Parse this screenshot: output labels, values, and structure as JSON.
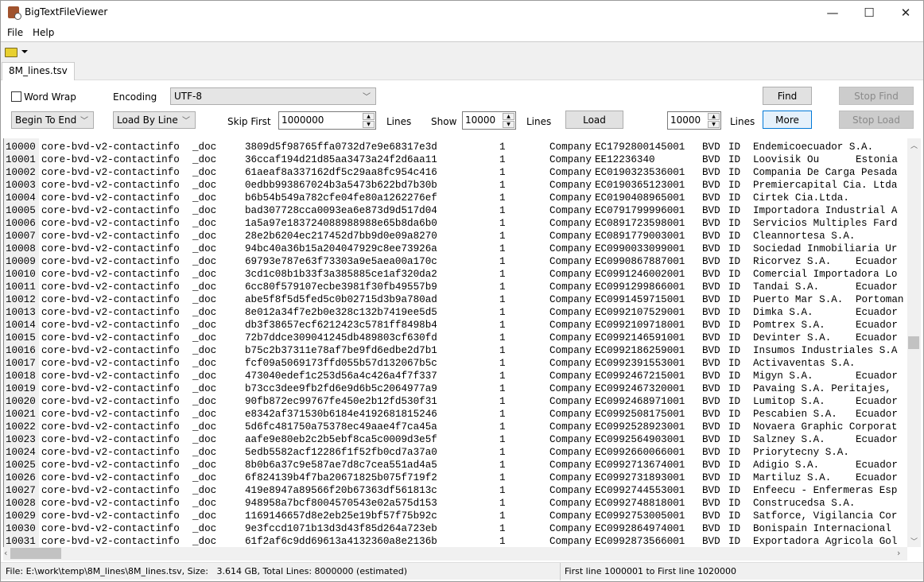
{
  "window": {
    "title": "BigTextFileViewer",
    "minimize": "—",
    "maximize": "☐",
    "close": "✕"
  },
  "menu": [
    "File",
    "Help"
  ],
  "toolbar": {
    "open_icon": "folder-open-icon",
    "dropdown_icon": "caret-down-icon"
  },
  "tab": {
    "label": "8M_lines.tsv"
  },
  "controls": {
    "word_wrap_label": "Word Wrap",
    "word_wrap_checked": false,
    "encoding_label": "Encoding",
    "encoding_value": "UTF-8",
    "direction_value": "Begin To End",
    "load_mode_value": "Load By Line",
    "skip_first_label": "Skip First",
    "skip_first_value": "1000000",
    "lines_label": "Lines",
    "show_label": "Show",
    "show_value": "10000",
    "load_label": "Load",
    "more_count_value": "10000",
    "more_label": "More",
    "find_label": "Find",
    "stop_find_label": "Stop Find",
    "stop_load_label": "Stop Load"
  },
  "rows": [
    [
      "10000",
      "core-bvd-v2-contactinfo",
      "_doc",
      "3809d5f98765ffa0732d7e9e68317e3d",
      "1",
      "Company",
      "EC1792800145001",
      "BVD",
      "ID",
      "Endemicoecuador S.A.",
      ""
    ],
    [
      "10001",
      "core-bvd-v2-contactinfo",
      "_doc",
      "36ccaf194d21d85aa3473a24f2d6aa11",
      "1",
      "Company",
      "EE12236340",
      "BVD",
      "ID",
      "Loovisik Ou",
      "Estonia"
    ],
    [
      "10002",
      "core-bvd-v2-contactinfo",
      "_doc",
      "61aeaf8a337162df5c29aa8fc954c416",
      "1",
      "Company",
      "EC0190323536001",
      "BVD",
      "ID",
      "Compania De Carga Pesada",
      ""
    ],
    [
      "10003",
      "core-bvd-v2-contactinfo",
      "_doc",
      "0edbb993867024b3a5473b622bd7b30b",
      "1",
      "Company",
      "EC0190365123001",
      "BVD",
      "ID",
      "Premiercapital Cia. Ltda",
      ""
    ],
    [
      "10004",
      "core-bvd-v2-contactinfo",
      "_doc",
      "b6b54b549a782cfe04fe80a1262276ef",
      "1",
      "Company",
      "EC0190408965001",
      "BVD",
      "ID",
      "Cirtek Cia.Ltda.",
      ""
    ],
    [
      "10005",
      "core-bvd-v2-contactinfo",
      "_doc",
      "bad307728cca0093ea6e873d9d517d04",
      "1",
      "Company",
      "EC0791799996001",
      "BVD",
      "ID",
      "Importadora Industrial A",
      ""
    ],
    [
      "10006",
      "core-bvd-v2-contactinfo",
      "_doc",
      "1a5a97e183724088988988e65b8da6b0",
      "1",
      "Company",
      "EC0891723598001",
      "BVD",
      "ID",
      "Servicios Multiples Fard",
      ""
    ],
    [
      "10007",
      "core-bvd-v2-contactinfo",
      "_doc",
      "28e2b6204ec217452d7bb9d0e09a8270",
      "1",
      "Company",
      "EC0891779003001",
      "BVD",
      "ID",
      "Cleannortesa S.A.",
      ""
    ],
    [
      "10008",
      "core-bvd-v2-contactinfo",
      "_doc",
      "94bc40a36b15a204047929c8ee73926a",
      "1",
      "Company",
      "EC0990033099001",
      "BVD",
      "ID",
      "Sociedad Inmobiliaria Ur",
      ""
    ],
    [
      "10009",
      "core-bvd-v2-contactinfo",
      "_doc",
      "69793e787e63f73303a9e5aea00a170c",
      "1",
      "Company",
      "EC0990867887001",
      "BVD",
      "ID",
      "Ricorvez S.A.",
      "Ecuador"
    ],
    [
      "10010",
      "core-bvd-v2-contactinfo",
      "_doc",
      "3cd1c08b1b33f3a385885ce1af320da2",
      "1",
      "Company",
      "EC0991246002001",
      "BVD",
      "ID",
      "Comercial Importadora Lo",
      ""
    ],
    [
      "10011",
      "core-bvd-v2-contactinfo",
      "_doc",
      "6cc80f579107ecbe3981f30fb49557b9",
      "1",
      "Company",
      "EC0991299866001",
      "BVD",
      "ID",
      "Tandai S.A.",
      "Ecuador"
    ],
    [
      "10012",
      "core-bvd-v2-contactinfo",
      "_doc",
      "abe5f8f5d5fed5c0b02715d3b9a780ad",
      "1",
      "Company",
      "EC0991459715001",
      "BVD",
      "ID",
      "Puerto Mar S.A.",
      "Portoman"
    ],
    [
      "10013",
      "core-bvd-v2-contactinfo",
      "_doc",
      "8e012a34f7e2b0e328c132b7419ee5d5",
      "1",
      "Company",
      "EC0992107529001",
      "BVD",
      "ID",
      "Dimka S.A.",
      "Ecuador"
    ],
    [
      "10014",
      "core-bvd-v2-contactinfo",
      "_doc",
      "db3f38657ecf6212423c5781ff8498b4",
      "1",
      "Company",
      "EC0992109718001",
      "BVD",
      "ID",
      "Pomtrex S.A.",
      "Ecuador"
    ],
    [
      "10015",
      "core-bvd-v2-contactinfo",
      "_doc",
      "72b7ddce309041245db489803cf630fd",
      "1",
      "Company",
      "EC0992146591001",
      "BVD",
      "ID",
      "Devinter S.A.",
      "Ecuador"
    ],
    [
      "10016",
      "core-bvd-v2-contactinfo",
      "_doc",
      "b75c2b37311e78af7be9fd6edbe2d7b1",
      "1",
      "Company",
      "EC0992186259001",
      "BVD",
      "ID",
      "Insumos Industriales S.A",
      ""
    ],
    [
      "10017",
      "core-bvd-v2-contactinfo",
      "_doc",
      "fcf09a5069173ffd055b57d132067b5c",
      "1",
      "Company",
      "EC0992391553001",
      "BVD",
      "ID",
      "Activaventas S.A.",
      ""
    ],
    [
      "10018",
      "core-bvd-v2-contactinfo",
      "_doc",
      "473040edef1c253d56a4c426a4f7f337",
      "1",
      "Company",
      "EC0992467215001",
      "BVD",
      "ID",
      "Migyn S.A.",
      "Ecuador"
    ],
    [
      "10019",
      "core-bvd-v2-contactinfo",
      "_doc",
      "b73cc3dee9fb2fd6e9d6b5c2064977a9",
      "1",
      "Company",
      "EC0992467320001",
      "BVD",
      "ID",
      "Pavaing S.A. Peritajes,",
      ""
    ],
    [
      "10020",
      "core-bvd-v2-contactinfo",
      "_doc",
      "90fb872ec99767fe450e2b12fd530f31",
      "1",
      "Company",
      "EC0992468971001",
      "BVD",
      "ID",
      "Lumitop S.A.",
      "Ecuador"
    ],
    [
      "10021",
      "core-bvd-v2-contactinfo",
      "_doc",
      "e8342af371530b6184e4192681815246",
      "1",
      "Company",
      "EC0992508175001",
      "BVD",
      "ID",
      "Pescabien S.A.",
      "Ecuador"
    ],
    [
      "10022",
      "core-bvd-v2-contactinfo",
      "_doc",
      "5d6fc481750a75378ec49aae4f7ca45a",
      "1",
      "Company",
      "EC0992528923001",
      "BVD",
      "ID",
      "Novaera Graphic Corporat",
      ""
    ],
    [
      "10023",
      "core-bvd-v2-contactinfo",
      "_doc",
      "aafe9e80eb2c2b5ebf8ca5c0009d3e5f",
      "1",
      "Company",
      "EC0992564903001",
      "BVD",
      "ID",
      "Salzney S.A.",
      "Ecuador"
    ],
    [
      "10024",
      "core-bvd-v2-contactinfo",
      "_doc",
      "5edb5582acf12286f1f52fb0cd7a37a0",
      "1",
      "Company",
      "EC0992660066001",
      "BVD",
      "ID",
      "Priorytecny S.A.",
      ""
    ],
    [
      "10025",
      "core-bvd-v2-contactinfo",
      "_doc",
      "8b0b6a37c9e587ae7d8c7cea551ad4a5",
      "1",
      "Company",
      "EC0992713674001",
      "BVD",
      "ID",
      "Adigio S.A.",
      "Ecuador"
    ],
    [
      "10026",
      "core-bvd-v2-contactinfo",
      "_doc",
      "6f824139b4f7ba20671825b075f719f2",
      "1",
      "Company",
      "EC0992731893001",
      "BVD",
      "ID",
      "Martiluz S.A.",
      "Ecuador"
    ],
    [
      "10027",
      "core-bvd-v2-contactinfo",
      "_doc",
      "419e8947a89566f20b67363df561813c",
      "1",
      "Company",
      "EC0992744553001",
      "BVD",
      "ID",
      "Enfeecu - Enfermeras Esp",
      ""
    ],
    [
      "10028",
      "core-bvd-v2-contactinfo",
      "_doc",
      "948958a7bcf8004570543e02a575d153",
      "1",
      "Company",
      "EC0992748818001",
      "BVD",
      "ID",
      "Construcedsa S.A.",
      ""
    ],
    [
      "10029",
      "core-bvd-v2-contactinfo",
      "_doc",
      "1169146657d8e2eb25e19bf57f75b92c",
      "1",
      "Company",
      "EC0992753005001",
      "BVD",
      "ID",
      "Satforce, Vigilancia Cor",
      ""
    ],
    [
      "10030",
      "core-bvd-v2-contactinfo",
      "_doc",
      "9e3fccd1071b13d3d43f85d264a723eb",
      "1",
      "Company",
      "EC0992864974001",
      "BVD",
      "ID",
      "Bonispain Internacional",
      ""
    ],
    [
      "10031",
      "core-bvd-v2-contactinfo",
      "_doc",
      "61f2af6c9dd69613a4132360a8e2136b",
      "1",
      "Company",
      "EC0992873566001",
      "BVD",
      "ID",
      "Exportadora Agricola Gol",
      ""
    ]
  ],
  "status": {
    "file_info": "File: E:\\work\\temp\\8M_lines\\8M_lines.tsv, Size:   3.614 GB, Total Lines: 8000000 (estimated)",
    "range": "First line 1000001 to First line 1020000"
  }
}
